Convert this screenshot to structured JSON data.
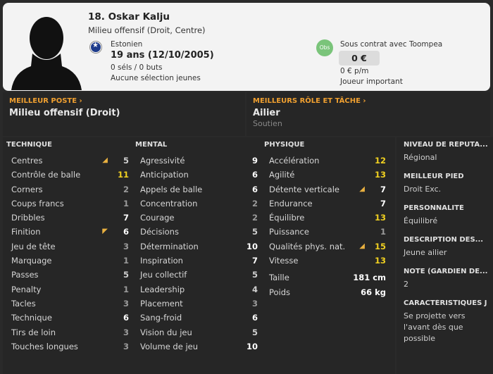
{
  "header": {
    "name": "18. Oskar Kalju",
    "position": "Milieu offensif (Droit, Centre)",
    "nationality": "Estonien",
    "age": "19 ans (12/10/2005)",
    "caps": "0 séls / 0 buts",
    "youth": "Aucune sélection jeunes",
    "obs_badge": "Obs",
    "contract": "Sous contrat avec Toompea",
    "value": "0 €",
    "wage": "0 € p/m",
    "status": "Joueur important"
  },
  "roles": {
    "best_position_title": "MEILLEUR POSTE",
    "best_position": "Milieu offensif (Droit)",
    "best_role_title": "MEILLEURS RÔLE ET TÂCHE",
    "best_role": "Ailier",
    "best_duty": "Soutien"
  },
  "technique": {
    "title": "TECHNIQUE",
    "items": [
      {
        "label": "Centres",
        "value": "5",
        "arrow": "up"
      },
      {
        "label": "Contrôle de balle",
        "value": "11",
        "arrow": ""
      },
      {
        "label": "Corners",
        "value": "2",
        "arrow": ""
      },
      {
        "label": "Coups francs",
        "value": "1",
        "arrow": ""
      },
      {
        "label": "Dribbles",
        "value": "7",
        "arrow": ""
      },
      {
        "label": "Finition",
        "value": "6",
        "arrow": "down"
      },
      {
        "label": "Jeu de tête",
        "value": "3",
        "arrow": ""
      },
      {
        "label": "Marquage",
        "value": "1",
        "arrow": ""
      },
      {
        "label": "Passes",
        "value": "5",
        "arrow": ""
      },
      {
        "label": "Penalty",
        "value": "1",
        "arrow": ""
      },
      {
        "label": "Tacles",
        "value": "3",
        "arrow": ""
      },
      {
        "label": "Technique",
        "value": "6",
        "arrow": ""
      },
      {
        "label": "Tirs de loin",
        "value": "3",
        "arrow": ""
      },
      {
        "label": "Touches longues",
        "value": "3",
        "arrow": ""
      }
    ]
  },
  "mental": {
    "title": "MENTAL",
    "items": [
      {
        "label": "Agressivité",
        "value": "9",
        "arrow": ""
      },
      {
        "label": "Anticipation",
        "value": "6",
        "arrow": ""
      },
      {
        "label": "Appels de balle",
        "value": "6",
        "arrow": ""
      },
      {
        "label": "Concentration",
        "value": "2",
        "arrow": ""
      },
      {
        "label": "Courage",
        "value": "2",
        "arrow": ""
      },
      {
        "label": "Décisions",
        "value": "5",
        "arrow": ""
      },
      {
        "label": "Détermination",
        "value": "10",
        "arrow": ""
      },
      {
        "label": "Inspiration",
        "value": "7",
        "arrow": ""
      },
      {
        "label": "Jeu collectif",
        "value": "5",
        "arrow": ""
      },
      {
        "label": "Leadership",
        "value": "4",
        "arrow": ""
      },
      {
        "label": "Placement",
        "value": "3",
        "arrow": ""
      },
      {
        "label": "Sang-froid",
        "value": "6",
        "arrow": ""
      },
      {
        "label": "Vision du jeu",
        "value": "5",
        "arrow": ""
      },
      {
        "label": "Volume de jeu",
        "value": "10",
        "arrow": ""
      }
    ]
  },
  "physique": {
    "title": "PHYSIQUE",
    "items": [
      {
        "label": "Accélération",
        "value": "12",
        "arrow": ""
      },
      {
        "label": "Agilité",
        "value": "13",
        "arrow": ""
      },
      {
        "label": "Détente verticale",
        "value": "7",
        "arrow": "up"
      },
      {
        "label": "Endurance",
        "value": "7",
        "arrow": ""
      },
      {
        "label": "Équilibre",
        "value": "13",
        "arrow": ""
      },
      {
        "label": "Puissance",
        "value": "1",
        "arrow": ""
      },
      {
        "label": "Qualités phys. nat.",
        "value": "15",
        "arrow": "up"
      },
      {
        "label": "Vitesse",
        "value": "13",
        "arrow": ""
      }
    ],
    "extra": [
      {
        "label": "Taille",
        "value": "181 cm"
      },
      {
        "label": "Poids",
        "value": "66 kg"
      }
    ]
  },
  "side": [
    {
      "title": "NIVEAU DE RÉPUTA...",
      "value": "Régional"
    },
    {
      "title": "MEILLEUR PIED",
      "value": "Droit Exc."
    },
    {
      "title": "PERSONNALITÉ",
      "value": "Équilibré"
    },
    {
      "title": "DESCRIPTION DES...",
      "value": "Jeune ailier"
    },
    {
      "title": "NOTE (GARDIEN DE...",
      "value": "2"
    },
    {
      "title": "CARACTÉRISTIQUES J",
      "value": "Se projette vers l'avant dès que possible"
    }
  ]
}
